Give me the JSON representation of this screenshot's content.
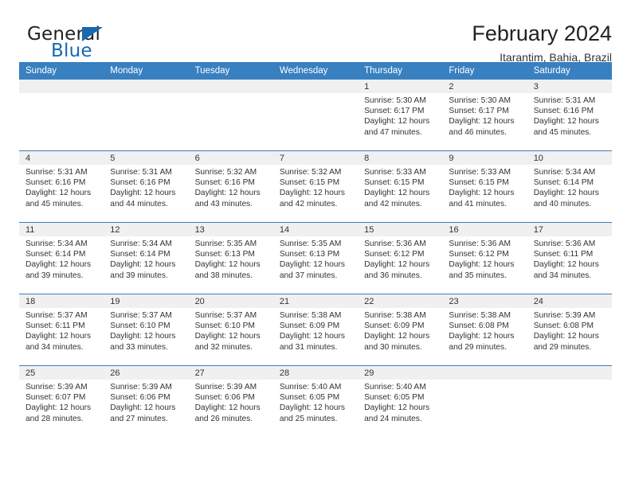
{
  "brand": {
    "name_part1": "General",
    "name_part2": "Blue",
    "logo_icon": "triangle-logo-icon"
  },
  "header": {
    "title": "February 2024",
    "subtitle": "Itarantim, Bahia, Brazil"
  },
  "calendar": {
    "weekday_headers": [
      "Sunday",
      "Monday",
      "Tuesday",
      "Wednesday",
      "Thursday",
      "Friday",
      "Saturday"
    ],
    "accent_color": "#3880c0",
    "daynum_band_color": "#f0f0f0",
    "weeks": [
      [
        {
          "day": "",
          "lines": []
        },
        {
          "day": "",
          "lines": []
        },
        {
          "day": "",
          "lines": []
        },
        {
          "day": "",
          "lines": []
        },
        {
          "day": "1",
          "lines": [
            "Sunrise: 5:30 AM",
            "Sunset: 6:17 PM",
            "Daylight: 12 hours",
            "and 47 minutes."
          ]
        },
        {
          "day": "2",
          "lines": [
            "Sunrise: 5:30 AM",
            "Sunset: 6:17 PM",
            "Daylight: 12 hours",
            "and 46 minutes."
          ]
        },
        {
          "day": "3",
          "lines": [
            "Sunrise: 5:31 AM",
            "Sunset: 6:16 PM",
            "Daylight: 12 hours",
            "and 45 minutes."
          ]
        }
      ],
      [
        {
          "day": "4",
          "lines": [
            "Sunrise: 5:31 AM",
            "Sunset: 6:16 PM",
            "Daylight: 12 hours",
            "and 45 minutes."
          ]
        },
        {
          "day": "5",
          "lines": [
            "Sunrise: 5:31 AM",
            "Sunset: 6:16 PM",
            "Daylight: 12 hours",
            "and 44 minutes."
          ]
        },
        {
          "day": "6",
          "lines": [
            "Sunrise: 5:32 AM",
            "Sunset: 6:16 PM",
            "Daylight: 12 hours",
            "and 43 minutes."
          ]
        },
        {
          "day": "7",
          "lines": [
            "Sunrise: 5:32 AM",
            "Sunset: 6:15 PM",
            "Daylight: 12 hours",
            "and 42 minutes."
          ]
        },
        {
          "day": "8",
          "lines": [
            "Sunrise: 5:33 AM",
            "Sunset: 6:15 PM",
            "Daylight: 12 hours",
            "and 42 minutes."
          ]
        },
        {
          "day": "9",
          "lines": [
            "Sunrise: 5:33 AM",
            "Sunset: 6:15 PM",
            "Daylight: 12 hours",
            "and 41 minutes."
          ]
        },
        {
          "day": "10",
          "lines": [
            "Sunrise: 5:34 AM",
            "Sunset: 6:14 PM",
            "Daylight: 12 hours",
            "and 40 minutes."
          ]
        }
      ],
      [
        {
          "day": "11",
          "lines": [
            "Sunrise: 5:34 AM",
            "Sunset: 6:14 PM",
            "Daylight: 12 hours",
            "and 39 minutes."
          ]
        },
        {
          "day": "12",
          "lines": [
            "Sunrise: 5:34 AM",
            "Sunset: 6:14 PM",
            "Daylight: 12 hours",
            "and 39 minutes."
          ]
        },
        {
          "day": "13",
          "lines": [
            "Sunrise: 5:35 AM",
            "Sunset: 6:13 PM",
            "Daylight: 12 hours",
            "and 38 minutes."
          ]
        },
        {
          "day": "14",
          "lines": [
            "Sunrise: 5:35 AM",
            "Sunset: 6:13 PM",
            "Daylight: 12 hours",
            "and 37 minutes."
          ]
        },
        {
          "day": "15",
          "lines": [
            "Sunrise: 5:36 AM",
            "Sunset: 6:12 PM",
            "Daylight: 12 hours",
            "and 36 minutes."
          ]
        },
        {
          "day": "16",
          "lines": [
            "Sunrise: 5:36 AM",
            "Sunset: 6:12 PM",
            "Daylight: 12 hours",
            "and 35 minutes."
          ]
        },
        {
          "day": "17",
          "lines": [
            "Sunrise: 5:36 AM",
            "Sunset: 6:11 PM",
            "Daylight: 12 hours",
            "and 34 minutes."
          ]
        }
      ],
      [
        {
          "day": "18",
          "lines": [
            "Sunrise: 5:37 AM",
            "Sunset: 6:11 PM",
            "Daylight: 12 hours",
            "and 34 minutes."
          ]
        },
        {
          "day": "19",
          "lines": [
            "Sunrise: 5:37 AM",
            "Sunset: 6:10 PM",
            "Daylight: 12 hours",
            "and 33 minutes."
          ]
        },
        {
          "day": "20",
          "lines": [
            "Sunrise: 5:37 AM",
            "Sunset: 6:10 PM",
            "Daylight: 12 hours",
            "and 32 minutes."
          ]
        },
        {
          "day": "21",
          "lines": [
            "Sunrise: 5:38 AM",
            "Sunset: 6:09 PM",
            "Daylight: 12 hours",
            "and 31 minutes."
          ]
        },
        {
          "day": "22",
          "lines": [
            "Sunrise: 5:38 AM",
            "Sunset: 6:09 PM",
            "Daylight: 12 hours",
            "and 30 minutes."
          ]
        },
        {
          "day": "23",
          "lines": [
            "Sunrise: 5:38 AM",
            "Sunset: 6:08 PM",
            "Daylight: 12 hours",
            "and 29 minutes."
          ]
        },
        {
          "day": "24",
          "lines": [
            "Sunrise: 5:39 AM",
            "Sunset: 6:08 PM",
            "Daylight: 12 hours",
            "and 29 minutes."
          ]
        }
      ],
      [
        {
          "day": "25",
          "lines": [
            "Sunrise: 5:39 AM",
            "Sunset: 6:07 PM",
            "Daylight: 12 hours",
            "and 28 minutes."
          ]
        },
        {
          "day": "26",
          "lines": [
            "Sunrise: 5:39 AM",
            "Sunset: 6:06 PM",
            "Daylight: 12 hours",
            "and 27 minutes."
          ]
        },
        {
          "day": "27",
          "lines": [
            "Sunrise: 5:39 AM",
            "Sunset: 6:06 PM",
            "Daylight: 12 hours",
            "and 26 minutes."
          ]
        },
        {
          "day": "28",
          "lines": [
            "Sunrise: 5:40 AM",
            "Sunset: 6:05 PM",
            "Daylight: 12 hours",
            "and 25 minutes."
          ]
        },
        {
          "day": "29",
          "lines": [
            "Sunrise: 5:40 AM",
            "Sunset: 6:05 PM",
            "Daylight: 12 hours",
            "and 24 minutes."
          ]
        },
        {
          "day": "",
          "lines": []
        },
        {
          "day": "",
          "lines": []
        }
      ]
    ]
  }
}
